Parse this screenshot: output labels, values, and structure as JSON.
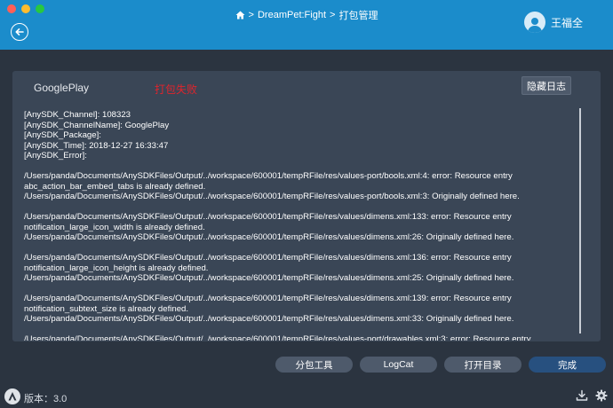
{
  "header": {
    "breadcrumb": {
      "project": "DreamPet:Fight",
      "separator": ">",
      "page": "打包管理"
    },
    "user": {
      "name": "王福全"
    }
  },
  "panel": {
    "channel_tab": "GooglePlay",
    "status_text": "打包失败",
    "hide_log_label": "隐藏日志",
    "log_text": "[AnySDK_Channel]: 108323\n[AnySDK_ChannelName]: GooglePlay\n[AnySDK_Package]:\n[AnySDK_Time]: 2018-12-27 16:33:47\n[AnySDK_Error]:\n\n/Users/panda/Documents/AnySDKFiles/Output/../workspace/600001/tempRFile/res/values-port/bools.xml:4: error: Resource entry\nabc_action_bar_embed_tabs is already defined.\n/Users/panda/Documents/AnySDKFiles/Output/../workspace/600001/tempRFile/res/values-port/bools.xml:3: Originally defined here.\n\n/Users/panda/Documents/AnySDKFiles/Output/../workspace/600001/tempRFile/res/values/dimens.xml:133: error: Resource entry\nnotification_large_icon_width is already defined.\n/Users/panda/Documents/AnySDKFiles/Output/../workspace/600001/tempRFile/res/values/dimens.xml:26: Originally defined here.\n\n/Users/panda/Documents/AnySDKFiles/Output/../workspace/600001/tempRFile/res/values/dimens.xml:136: error: Resource entry\nnotification_large_icon_height is already defined.\n/Users/panda/Documents/AnySDKFiles/Output/../workspace/600001/tempRFile/res/values/dimens.xml:25: Originally defined here.\n\n/Users/panda/Documents/AnySDKFiles/Output/../workspace/600001/tempRFile/res/values/dimens.xml:139: error: Resource entry\nnotification_subtext_size is already defined.\n/Users/panda/Documents/AnySDKFiles/Output/../workspace/600001/tempRFile/res/values/dimens.xml:33: Originally defined here.\n\n/Users/panda/Documents/AnySDKFiles/Output/../workspace/600001/tempRFile/res/values-port/drawables.xml:3: error: Resource entry"
  },
  "actions": {
    "split_tool": "分包工具",
    "logcat": "LogCat",
    "open_dir": "打开目录",
    "done": "完成"
  },
  "footer": {
    "version": "版本：3.0"
  },
  "colors": {
    "header_bg": "#1b8ccb",
    "window_bg": "#2b3440",
    "panel_bg": "#3a4656",
    "error_red": "#e0242c",
    "primary_button": "#27507f"
  },
  "icons": {
    "back": "back-arrow-circle-icon",
    "home": "home-icon",
    "avatar": "user-avatar-icon",
    "logo": "anysdk-logo-icon",
    "download": "download-icon",
    "settings": "gear-icon"
  }
}
